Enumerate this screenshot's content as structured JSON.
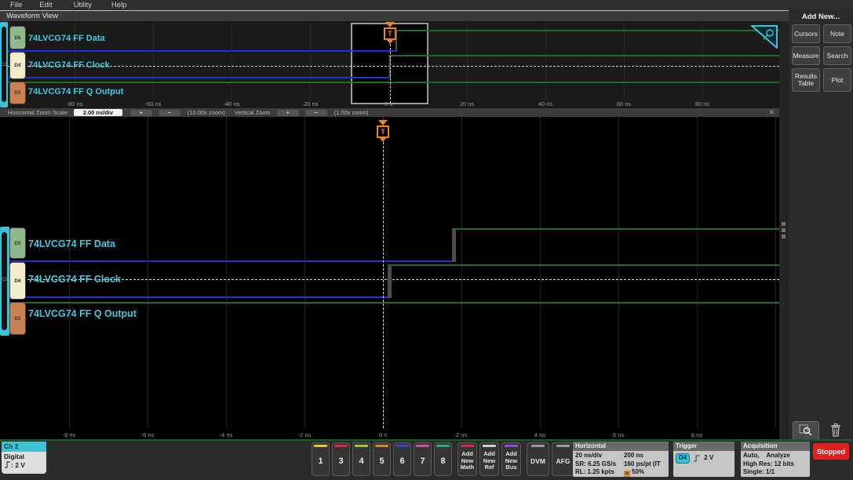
{
  "menu": {
    "items": [
      "File",
      "Edit",
      "Utility",
      "Help"
    ]
  },
  "view_tab": "Waveform View",
  "group_label": "C2",
  "trigger": {
    "label": "T"
  },
  "channels": [
    {
      "badge": "D5",
      "label": "74LVCG74 FF Data"
    },
    {
      "badge": "D4",
      "label": "74LVCG74 FF Clock"
    },
    {
      "badge": "D3",
      "label": "74LVCG74 FF Q Output"
    }
  ],
  "signals": {
    "d5_data": {
      "initial": "low",
      "edge": "rising",
      "edge_at_ns": 1.76
    },
    "d4_clock": {
      "initial": "low",
      "edge": "rising",
      "edge_at_ns": 0.12,
      "threshold_line": "dashed"
    },
    "d3_q": {
      "constant": "high"
    }
  },
  "overview": {
    "axis_ticks": [
      "-80 ns",
      "-60 ns",
      "-40 ns",
      "-20 ns",
      "0 s",
      "20 ns",
      "40 ns",
      "60 ns",
      "80 ns"
    ]
  },
  "main_view": {
    "axis_ticks": [
      "-8 ns",
      "-6 ns",
      "-4 ns",
      "-2 ns",
      "0 s",
      "2 ns",
      "4 ns",
      "6 ns",
      "8 ns"
    ]
  },
  "zoom_bar": {
    "h_label": "Horizontal Zoom Scale",
    "h_value": "2.00 ns/div",
    "plus": "+",
    "minus": "−",
    "h_zoom": "(10.00x zoom)",
    "v_label": "Vertical Zoom",
    "v_zoom": "(1.00x zoom)",
    "close": "✕"
  },
  "sidebar": {
    "title": "Add New...",
    "buttons": [
      "Cursors",
      "Note",
      "Measure",
      "Search",
      "Results Table",
      "Plot"
    ]
  },
  "bottom": {
    "ch2": {
      "name": "Ch 2",
      "type": "Digital",
      "threshold": ": 2 V"
    },
    "channel_buttons": [
      {
        "label": "1",
        "color": "#e3c93c"
      },
      {
        "label": "3",
        "color": "#cc2b4a"
      },
      {
        "label": "4",
        "color": "#9fc52c"
      },
      {
        "label": "5",
        "color": "#e0812f"
      },
      {
        "label": "6",
        "color": "#3946c8"
      },
      {
        "label": "7",
        "color": "#d24f93"
      },
      {
        "label": "8",
        "color": "#25b45f"
      }
    ],
    "add_buttons": [
      {
        "label": "Add New Math",
        "color": "#cc2b4a"
      },
      {
        "label": "Add New Ref",
        "color": "#cfcfcf"
      },
      {
        "label": "Add New Bus",
        "color": "#8a4fd2"
      }
    ],
    "instrument_buttons": [
      {
        "label": "DVM",
        "color": "#9a9a9a"
      },
      {
        "label": "AFG",
        "color": "#9a9a9a"
      }
    ],
    "horizontal": {
      "title": "Horizontal",
      "scale": "20 ns/div",
      "window": "200 ns",
      "sr": "SR: 6.25 GS/s",
      "resolution": "160 ps/pt (IT",
      "rl": "RL: 1.25 kpts",
      "position_icon": "u",
      "position": "50%"
    },
    "trigger": {
      "title": "Trigger",
      "source": "D4",
      "level": "2 V"
    },
    "acquisition": {
      "title": "Acquisition",
      "mode": "Auto,",
      "analyze": "Analyze",
      "res": "High Res: 12 bits",
      "single": "Single: 1/1"
    },
    "stopped": "Stopped"
  },
  "colors": {
    "accent_cyan": "#3ec1d5",
    "channel_label_cyan": "#41c9e2",
    "trigger_orange": "#f08418",
    "waveform_low_blue": "#2330c8",
    "waveform_high_green": "#1d6e2a",
    "stopped_red": "#e0201e"
  }
}
